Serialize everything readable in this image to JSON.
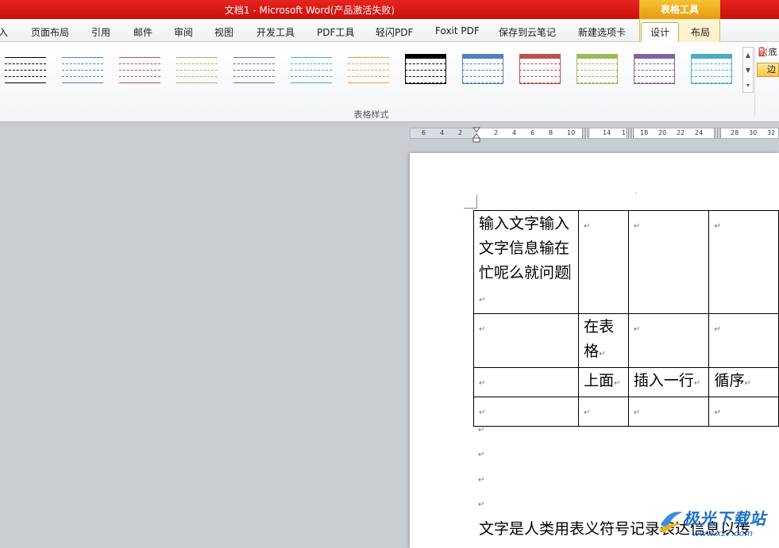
{
  "window": {
    "title": "文档1 - Microsoft Word(产品激活失败)",
    "context_tool_header": "表格工具"
  },
  "tabs": [
    {
      "label": "入",
      "x_hint": "partial"
    },
    {
      "label": "页面布局"
    },
    {
      "label": "引用"
    },
    {
      "label": "邮件"
    },
    {
      "label": "审阅"
    },
    {
      "label": "视图"
    },
    {
      "label": "开发工具"
    },
    {
      "label": "PDF工具"
    },
    {
      "label": "轻闪PDF"
    },
    {
      "label": "Foxit PDF"
    },
    {
      "label": "保存到云笔记"
    },
    {
      "label": "新建选项卡"
    },
    {
      "label": "设计",
      "active": true
    },
    {
      "label": "布局"
    }
  ],
  "ribbon": {
    "group_label": "表格样式",
    "shading_label": "底",
    "borders_label": "边",
    "table_styles": [
      {
        "name": "style-1",
        "color": "#000000"
      },
      {
        "name": "style-2",
        "color": "#4f81bd"
      },
      {
        "name": "style-3",
        "color": "#c0504d"
      },
      {
        "name": "style-4",
        "color": "#9bbb59"
      },
      {
        "name": "style-5",
        "color": "#8064a2"
      },
      {
        "name": "style-6",
        "color": "#4bacc6"
      },
      {
        "name": "style-7",
        "color": "#f79646"
      },
      {
        "name": "style-8",
        "color": "#000000"
      },
      {
        "name": "style-9",
        "color": "#4f81bd"
      },
      {
        "name": "style-10",
        "color": "#c0504d"
      },
      {
        "name": "style-11",
        "color": "#9bbb59"
      },
      {
        "name": "style-12",
        "color": "#8064a2"
      },
      {
        "name": "style-13",
        "color": "#4bacc6"
      }
    ]
  },
  "ruler": {
    "ticks": [
      "6",
      "4",
      "2",
      "2",
      "4",
      "6",
      "8",
      "10",
      "14",
      "16",
      "18",
      "20",
      "22",
      "24",
      "28",
      "30",
      "32"
    ]
  },
  "document": {
    "table": [
      [
        "输入文字输入文字信息输在忙呢么就问题",
        "",
        "",
        ""
      ],
      [
        "",
        "在表格",
        "",
        ""
      ],
      [
        "",
        "上面",
        "插入一行",
        "循序"
      ],
      [
        "",
        "",
        "",
        ""
      ]
    ],
    "body_text": "文字是人类用表义符号记录表达信息以传"
  },
  "watermark": {
    "text": "极光下载站",
    "url": "www.xz7.com"
  }
}
